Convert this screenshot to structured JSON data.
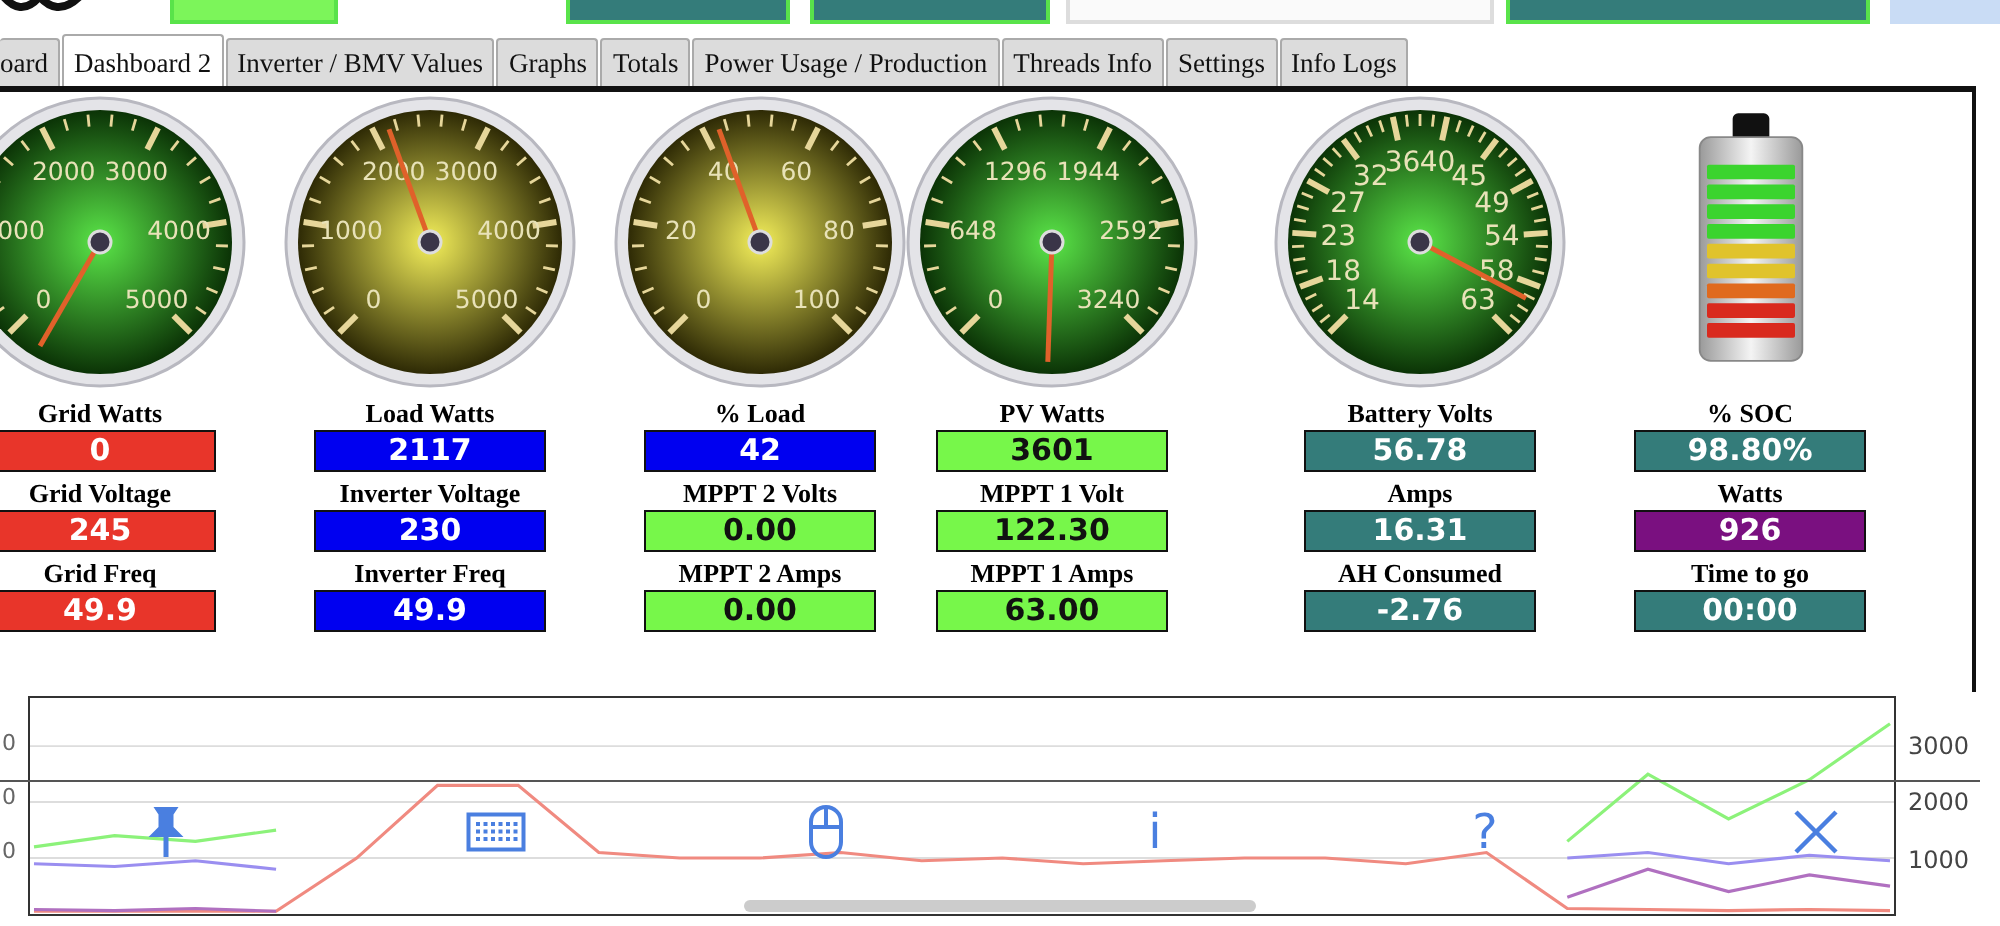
{
  "tabs": [
    {
      "label": "oard",
      "selected": false
    },
    {
      "label": "Dashboard 2",
      "selected": true
    },
    {
      "label": "Inverter / BMV Values",
      "selected": false
    },
    {
      "label": "Graphs",
      "selected": false
    },
    {
      "label": "Totals",
      "selected": false
    },
    {
      "label": "Power Usage / Production",
      "selected": false
    },
    {
      "label": "Threads Info",
      "selected": false
    },
    {
      "label": "Settings",
      "selected": false
    },
    {
      "label": "Info Logs",
      "selected": false
    }
  ],
  "gauges": [
    {
      "kind": "green",
      "labels": [
        "2000",
        "3000",
        "000",
        "4000",
        "0",
        "5000"
      ]
    },
    {
      "kind": "yellow",
      "labels": [
        "2000",
        "3000",
        "1000",
        "4000",
        "0",
        "5000"
      ]
    },
    {
      "kind": "yellow",
      "labels": [
        "40",
        "60",
        "20",
        "80",
        "0",
        "100"
      ]
    },
    {
      "kind": "green",
      "labels": [
        "1296",
        "1944",
        "648",
        "2592",
        "0",
        "3240"
      ]
    },
    {
      "kind": "green",
      "labels": [
        "32",
        "36",
        "40",
        "45",
        "27",
        "49",
        "23",
        "54",
        "18",
        "58",
        "14",
        "63"
      ]
    },
    {
      "kind": "battery"
    }
  ],
  "columns": [
    {
      "items": [
        {
          "label": "Grid Watts",
          "value": "0",
          "color": "#e8352a"
        },
        {
          "label": "Grid Voltage",
          "value": "245",
          "color": "#e8352a"
        },
        {
          "label": "Grid Freq",
          "value": "49.9",
          "color": "#e8352a"
        }
      ]
    },
    {
      "items": [
        {
          "label": "Load Watts",
          "value": "2117",
          "color": "#0000f0"
        },
        {
          "label": "Inverter Voltage",
          "value": "230",
          "color": "#0000f0"
        },
        {
          "label": "Inverter Freq",
          "value": "49.9",
          "color": "#0000f0"
        }
      ]
    },
    {
      "items": [
        {
          "label": "% Load",
          "value": "42",
          "color": "#0000f0"
        },
        {
          "label": "MPPT 2 Volts",
          "value": "0.00",
          "color": "#77f74a"
        },
        {
          "label": "MPPT 2 Amps",
          "value": "0.00",
          "color": "#77f74a"
        }
      ]
    },
    {
      "items": [
        {
          "label": "PV Watts",
          "value": "3601",
          "color": "#77f74a"
        },
        {
          "label": "MPPT 1 Volt",
          "value": "122.30",
          "color": "#77f74a"
        },
        {
          "label": "MPPT 1 Amps",
          "value": "63.00",
          "color": "#77f74a"
        }
      ]
    },
    {
      "items": [
        {
          "label": "Battery Volts",
          "value": "56.78",
          "color": "#347c7a"
        },
        {
          "label": "Amps",
          "value": "16.31",
          "color": "#347c7a"
        },
        {
          "label": "AH Consumed",
          "value": "-2.76",
          "color": "#347c7a"
        }
      ]
    },
    {
      "items": [
        {
          "label": "% SOC",
          "value": "98.80%",
          "color": "#347c7a"
        },
        {
          "label": "Watts",
          "value": "926",
          "color": "#7a1080"
        },
        {
          "label": "Time to go",
          "value": "00:00",
          "color": "#347c7a"
        }
      ]
    }
  ],
  "chart": {
    "left_axis": [
      "0",
      "0",
      "0"
    ],
    "chart_data": {
      "type": "line",
      "grid": true,
      "ylim": [
        0,
        3860
      ],
      "yticks": [
        3000,
        2000,
        1000
      ],
      "series": [
        {
          "color": "#f08a80",
          "values": [
            50,
            50,
            50,
            50,
            1000,
            2300,
            2300,
            1100,
            1000,
            1000,
            1100,
            950,
            1000,
            900,
            950,
            1000,
            1000,
            900,
            1100,
            100,
            80,
            60,
            80,
            60
          ]
        },
        {
          "color": "#8cf27a",
          "values": [
            1200,
            1400,
            1300,
            1500,
            null,
            null,
            null,
            null,
            null,
            null,
            null,
            null,
            null,
            null,
            null,
            null,
            null,
            null,
            null,
            1300,
            2500,
            1700,
            2400,
            3400
          ]
        },
        {
          "color": "#9a8ef0",
          "values": [
            900,
            850,
            950,
            800,
            null,
            null,
            null,
            null,
            null,
            null,
            null,
            null,
            null,
            null,
            null,
            null,
            null,
            null,
            null,
            1000,
            1100,
            900,
            1050,
            950
          ]
        },
        {
          "color": "#b070c0",
          "values": [
            80,
            60,
            100,
            50,
            null,
            null,
            null,
            null,
            null,
            null,
            null,
            null,
            null,
            null,
            null,
            null,
            null,
            null,
            null,
            300,
            800,
            400,
            700,
            500
          ]
        }
      ]
    }
  },
  "toolbar": [
    {
      "kind": "pin"
    },
    {
      "kind": "keyboard"
    },
    {
      "kind": "mouse"
    },
    {
      "kind": "glyph",
      "text": "i"
    },
    {
      "kind": "glyph",
      "text": "?"
    },
    {
      "kind": "close"
    }
  ]
}
